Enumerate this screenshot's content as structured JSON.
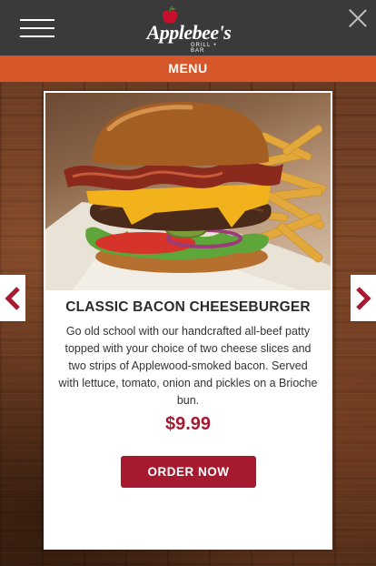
{
  "header": {
    "logo_text": "Applebee's",
    "logo_subtext": "GRILL + BAR"
  },
  "menu_bar": {
    "label": "MENU"
  },
  "dish": {
    "title": "CLASSIC BACON CHEESEBURGER",
    "description": "Go old school with our handcrafted all-beef patty topped with your choice of two cheese slices and two strips of Applewood-smoked bacon. Served with lettuce, tomato, onion and pickles on a Brioche bun.",
    "price": "$9.99",
    "order_label": "ORDER NOW"
  },
  "colors": {
    "header_bg": "#3a3a3a",
    "menu_bar": "#d5572a",
    "brand_red": "#a6192e"
  },
  "icons": {
    "menu": "hamburger-icon",
    "close": "close-icon",
    "prev": "chevron-left-icon",
    "next": "chevron-right-icon"
  }
}
